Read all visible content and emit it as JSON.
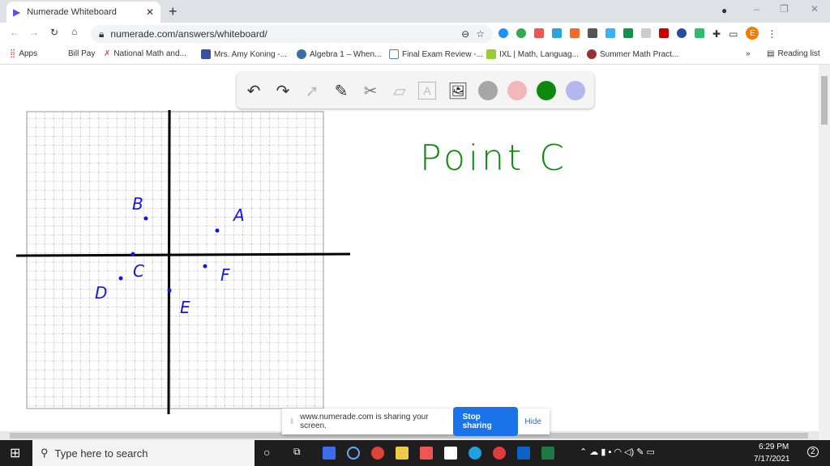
{
  "browser": {
    "tab_title": "Numerade Whiteboard",
    "url": "numerade.com/answers/whiteboard/",
    "bookmarks": [
      "Apps",
      "Bill Pay",
      "National Math and...",
      "Mrs. Amy Koning -...",
      "Algebra 1 – When...",
      "Final Exam Review -...",
      "IXL | Math, Languag...",
      "Summer Math Pract..."
    ],
    "reading_list": "Reading list",
    "profile_initial": "E",
    "more": "»"
  },
  "toolbar": {
    "tools": [
      "undo-icon",
      "redo-icon",
      "pointer-icon",
      "pen-icon",
      "tools-icon",
      "eraser-icon",
      "text-icon",
      "image-icon"
    ],
    "colors": [
      "#a6a6a6",
      "#f2b8b8",
      "#0d8a0d",
      "#b4b6ee"
    ]
  },
  "whiteboard": {
    "points": [
      {
        "label": "A"
      },
      {
        "label": "B"
      },
      {
        "label": "C"
      },
      {
        "label": "D"
      },
      {
        "label": "E"
      },
      {
        "label": "F"
      }
    ],
    "note": "Point C",
    "text_icon": "A"
  },
  "share_bar": {
    "message": "www.numerade.com is sharing your screen.",
    "stop": "Stop sharing",
    "hide": "Hide"
  },
  "taskbar": {
    "search_placeholder": "Type here to search",
    "time": "6:29 PM",
    "date": "7/17/2021",
    "notifications": "2"
  }
}
